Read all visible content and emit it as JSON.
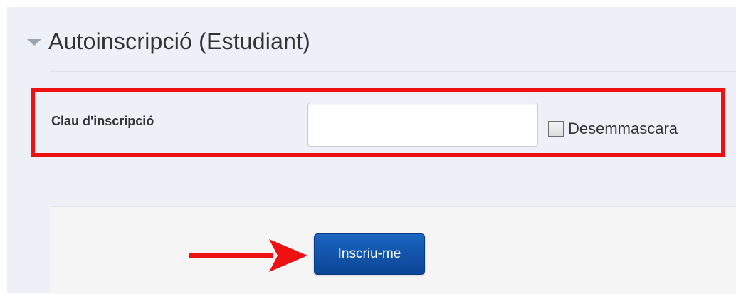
{
  "section": {
    "title": "Autoinscripció (Estudiant)",
    "toggle_icon": "collapse-triangle-down"
  },
  "form": {
    "enrolment_key_label": "Clau d'inscripció",
    "enrolment_key_value": "",
    "unmask_label": "Desemmascara",
    "unmask_checked": false,
    "submit_label": "Inscriu-me"
  },
  "annotations": {
    "highlight_color": "#ee1111",
    "arrow_icon": "red-arrow-right"
  },
  "colors": {
    "background": "#edf1f7",
    "button": "#0b4595"
  }
}
